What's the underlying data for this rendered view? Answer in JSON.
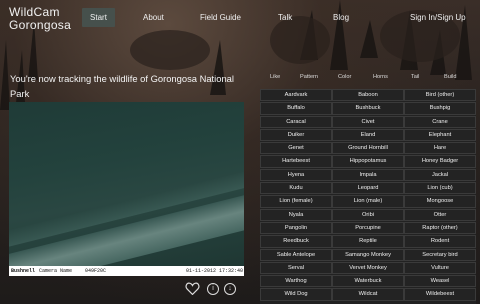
{
  "logo": {
    "line1": "WildCam",
    "line2": "Gorongosa"
  },
  "nav": {
    "start": "Start",
    "about": "About",
    "field_guide": "Field Guide",
    "talk": "Talk",
    "blog": "Blog",
    "sign_in": "Sign In/Sign Up"
  },
  "headline": "You're now tracking the wildlife of Gorongosa National Park",
  "video": {
    "brand": "Bushnell",
    "camera_name": "Camera Name",
    "temperature": "049F20C",
    "date": "01-11-2012",
    "time": "17:32:40"
  },
  "filters": [
    "Like",
    "Pattern",
    "Color",
    "Horns",
    "Tail",
    "Build"
  ],
  "animals": [
    "Aardvark",
    "Baboon",
    "Bird (other)",
    "Buffalo",
    "Bushbuck",
    "Bushpig",
    "Caracal",
    "Civet",
    "Crane",
    "Duiker",
    "Eland",
    "Elephant",
    "Genet",
    "Ground Hornbill",
    "Hare",
    "Hartebeest",
    "Hippopotamus",
    "Honey Badger",
    "Hyena",
    "Impala",
    "Jackal",
    "Kudu",
    "Leopard",
    "Lion (cub)",
    "Lion (female)",
    "Lion (male)",
    "Mongoose",
    "Nyala",
    "Oribi",
    "Otter",
    "Pangolin",
    "Porcupine",
    "Raptor (other)",
    "Reedbuck",
    "Reptile",
    "Rodent",
    "Sable Antelope",
    "Samango Monkey",
    "Secretary bird",
    "Serval",
    "Vervet Monkey",
    "Vulture",
    "Warthog",
    "Waterbuck",
    "Weasel",
    "Wild Dog",
    "Wildcat",
    "Wildebeest"
  ],
  "icons": {
    "heart": "heart-icon",
    "info": "info-icon",
    "download": "download-icon"
  }
}
